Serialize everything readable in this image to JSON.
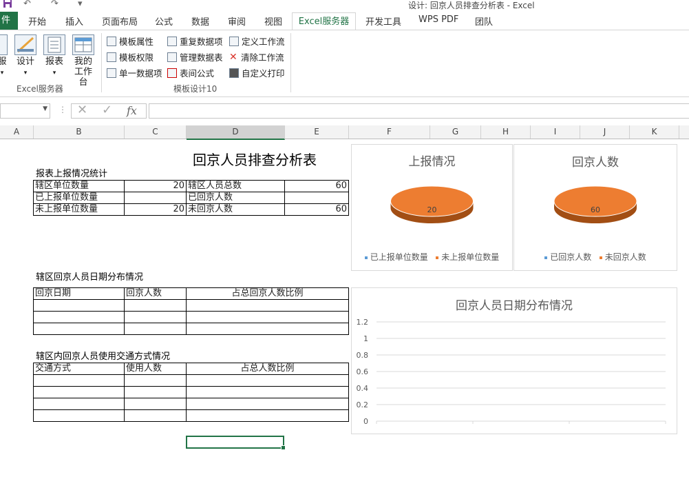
{
  "window": {
    "title": "设计: 回京人员排查分析表 - Excel"
  },
  "quick_access": {
    "save": "save-icon",
    "undo": "↶",
    "redo": "↷",
    "more": "▾"
  },
  "tabs": {
    "file": "件",
    "items": [
      "开始",
      "插入",
      "页面布局",
      "公式",
      "数据",
      "审阅",
      "视图",
      "Excel服务器",
      "开发工具",
      "WPS PDF",
      "团队"
    ],
    "active": "Excel服务器"
  },
  "ribbon": {
    "group1": {
      "label": "Excel服务器",
      "buttons": {
        "server": "服",
        "design": "设计",
        "report": "报表",
        "my_workbench_line1": "我的",
        "my_workbench_line2": "工作台"
      }
    },
    "group2": {
      "label": "模板设计10",
      "col1": [
        "模板属性",
        "模板权限",
        "单一数据项"
      ],
      "col2": [
        "重复数据项",
        "管理数据表",
        "表间公式"
      ],
      "col3": [
        "定义工作流",
        "清除工作流",
        "自定义打印"
      ]
    }
  },
  "formula_bar": {
    "namebox_value": "",
    "fx": "fx",
    "formula": ""
  },
  "columns": [
    "A",
    "B",
    "C",
    "D",
    "E",
    "F",
    "G",
    "H",
    "I",
    "J",
    "K"
  ],
  "sheet": {
    "title": "回京人员排查分析表",
    "section1": "报表上报情况统计",
    "table1": [
      [
        "辖区单位数量",
        "20",
        "辖区人员总数",
        "60"
      ],
      [
        "已上报单位数量",
        "",
        "已回京人数",
        ""
      ],
      [
        "未上报单位数量",
        "20",
        "未回京人数",
        "60"
      ]
    ],
    "section2": "辖区回京人员日期分布情况",
    "table2_header": [
      "回京日期",
      "回京人数",
      "占总回京人数比例"
    ],
    "section3": "辖区内回京人员使用交通方式情况",
    "table3_header": [
      "交通方式",
      "使用人数",
      "占总人数比例"
    ]
  },
  "colors": {
    "excel_green": "#217346",
    "pie_orange": "#ED7D31",
    "pie_blue": "#5B9BD5"
  },
  "chart_data": [
    {
      "type": "pie",
      "title": "上报情况",
      "categories": [
        "已上报单位数量",
        "未上报单位数量"
      ],
      "values": [
        0,
        20
      ],
      "data_labels": [
        "",
        "20"
      ],
      "legend": "bottom"
    },
    {
      "type": "pie",
      "title": "回京人数",
      "categories": [
        "已回京人数",
        "未回京人数"
      ],
      "values": [
        0,
        60
      ],
      "data_labels": [
        "",
        "60"
      ],
      "legend": "bottom"
    },
    {
      "type": "line",
      "title": "回京人员日期分布情况",
      "categories": [],
      "series": [],
      "ylim": [
        0,
        1.2
      ],
      "yticks": [
        "0",
        "0.2",
        "0.4",
        "0.6",
        "0.8",
        "1",
        "1.2"
      ],
      "grid": true
    }
  ]
}
